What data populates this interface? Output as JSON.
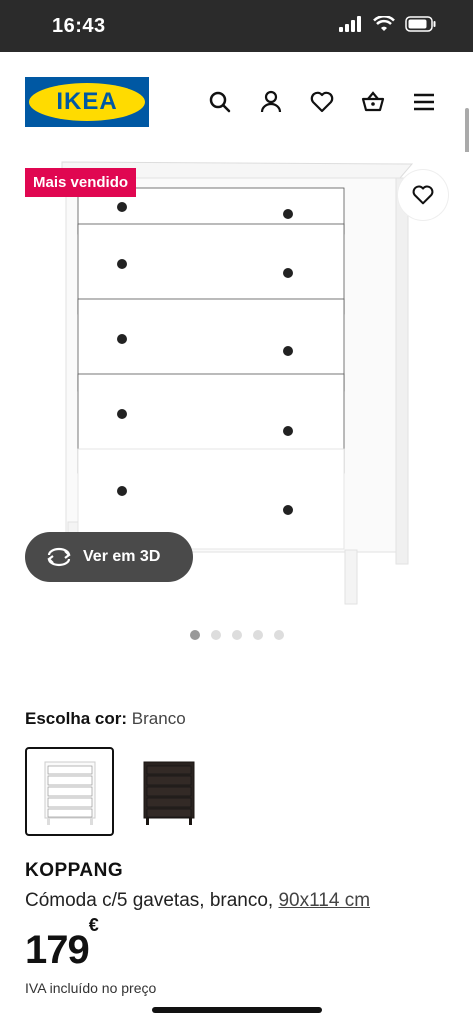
{
  "status": {
    "time": "16:43"
  },
  "header": {
    "logo_text": "IKEA",
    "brand_blue": "#0058a3",
    "brand_yellow": "#ffdb00",
    "icons": [
      "search-icon",
      "user-icon",
      "heart-icon",
      "basket-icon",
      "menu-icon"
    ]
  },
  "product": {
    "badge": "Mais vendido",
    "badge_color": "#e00751",
    "view3d_label": "Ver em 3D",
    "carousel": {
      "count": 5,
      "active_index": 0
    },
    "color_label": "Escolha cor:",
    "color_value": "Branco",
    "swatches": [
      {
        "name": "white",
        "selected": true
      },
      {
        "name": "dark-brown",
        "selected": false
      }
    ],
    "name": "KOPPANG",
    "description": "Cómoda c/5 gavetas, branco,",
    "size": "90x114 cm",
    "price_integer": "179",
    "price_currency": "€",
    "vat_note": "IVA incluído no preço"
  }
}
